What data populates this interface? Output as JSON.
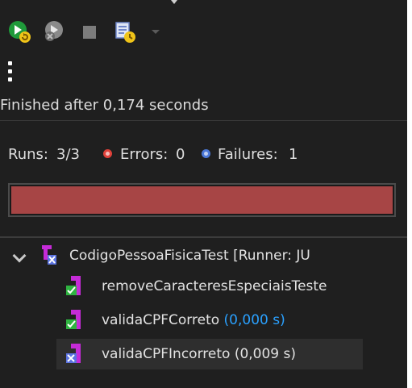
{
  "toolbar": {
    "buttons": [
      {
        "name": "rerun-test-icon",
        "enabled": true
      },
      {
        "name": "rerun-failed-first-icon",
        "enabled": false
      },
      {
        "name": "stop-icon",
        "enabled": false
      },
      {
        "name": "test-run-history-icon",
        "enabled": true
      }
    ],
    "more_menu_icon": "kebab-menu-icon"
  },
  "status": {
    "text": "Finished after 0,174 seconds"
  },
  "counters": {
    "runs_label": "Runs:",
    "runs_value": "3/3",
    "errors_label": "Errors:",
    "errors_value": "0",
    "failures_label": "Failures:",
    "failures_value": "1"
  },
  "progress": {
    "fraction": 1.0,
    "color": "#a74545"
  },
  "tree": {
    "root": {
      "label": "CodigoPessoaFisicaTest [Runner: JU",
      "status": "failed",
      "expanded": true
    },
    "items": [
      {
        "name": "removeCaracteresEspeciaisTeste",
        "time": "",
        "status": "passed"
      },
      {
        "name": "validaCPFCorreto",
        "time": "(0,000 s)",
        "status": "passed"
      },
      {
        "name": "validaCPFIncorreto",
        "time": "(0,009 s)",
        "status": "failed"
      }
    ]
  },
  "colors": {
    "background": "#1f1f1f",
    "text": "#dcdcdc",
    "error_dot": "#e0413a",
    "failure_dot": "#4b78d8",
    "time_highlight": "#2aa1ff",
    "pass_green": "#2fb441",
    "fail_blue": "#5b73e0",
    "test_magenta": "#c52bd8"
  }
}
